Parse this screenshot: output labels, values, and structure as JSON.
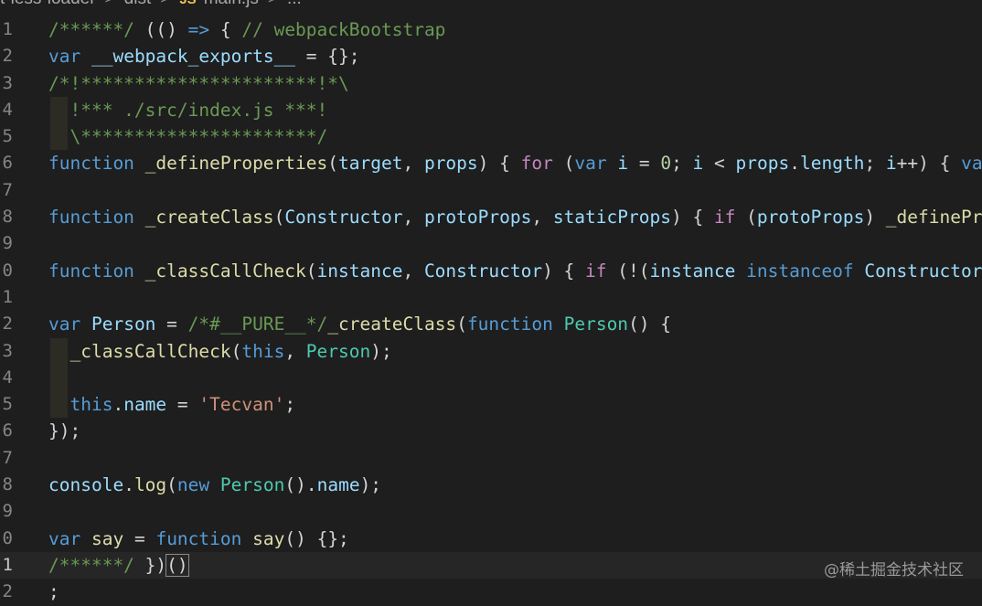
{
  "breadcrumb": {
    "segments": [
      "t-less-loader",
      "dist",
      "main.js",
      "..."
    ],
    "file_icon": "JS"
  },
  "editor": {
    "line_numbers": [
      "1",
      "2",
      "3",
      "4",
      "5",
      "6",
      "7",
      "8",
      "9",
      "0",
      "1",
      "2",
      "3",
      "4",
      "5",
      "6",
      "7",
      "8",
      "9",
      "0",
      "1",
      "2"
    ],
    "lines": [
      [
        [
          "m",
          "/******/ "
        ],
        [
          "p",
          "(() "
        ],
        [
          "k",
          "=>"
        ],
        [
          "p",
          " { "
        ],
        [
          "m",
          "// webpackBootstrap"
        ]
      ],
      [
        [
          "k",
          "var"
        ],
        [
          "p",
          " "
        ],
        [
          "v",
          "__webpack_exports__"
        ],
        [
          "p",
          " = {};"
        ]
      ],
      [
        [
          "m",
          "/*!**********************!*\\"
        ]
      ],
      [
        [
          "m",
          "  !*** ./src/index.js ***!"
        ]
      ],
      [
        [
          "m",
          "  \\**********************/"
        ]
      ],
      [
        [
          "k",
          "function"
        ],
        [
          "p",
          " "
        ],
        [
          "f",
          "_defineProperties"
        ],
        [
          "p",
          "("
        ],
        [
          "v",
          "target"
        ],
        [
          "p",
          ", "
        ],
        [
          "v",
          "props"
        ],
        [
          "p",
          ") { "
        ],
        [
          "c",
          "for"
        ],
        [
          "p",
          " ("
        ],
        [
          "k",
          "var"
        ],
        [
          "p",
          " "
        ],
        [
          "v",
          "i"
        ],
        [
          "p",
          " = "
        ],
        [
          "n",
          "0"
        ],
        [
          "p",
          "; "
        ],
        [
          "v",
          "i"
        ],
        [
          "p",
          " < "
        ],
        [
          "v",
          "props"
        ],
        [
          "p",
          "."
        ],
        [
          "v",
          "length"
        ],
        [
          "p",
          "; "
        ],
        [
          "v",
          "i"
        ],
        [
          "p",
          "++) { "
        ],
        [
          "k",
          "va"
        ]
      ],
      [],
      [
        [
          "k",
          "function"
        ],
        [
          "p",
          " "
        ],
        [
          "f",
          "_createClass"
        ],
        [
          "p",
          "("
        ],
        [
          "v",
          "Constructor"
        ],
        [
          "p",
          ", "
        ],
        [
          "v",
          "protoProps"
        ],
        [
          "p",
          ", "
        ],
        [
          "v",
          "staticProps"
        ],
        [
          "p",
          ") { "
        ],
        [
          "c",
          "if"
        ],
        [
          "p",
          " ("
        ],
        [
          "v",
          "protoProps"
        ],
        [
          "p",
          ") "
        ],
        [
          "f",
          "_definePr"
        ]
      ],
      [],
      [
        [
          "k",
          "function"
        ],
        [
          "p",
          " "
        ],
        [
          "f",
          "_classCallCheck"
        ],
        [
          "p",
          "("
        ],
        [
          "v",
          "instance"
        ],
        [
          "p",
          ", "
        ],
        [
          "v",
          "Constructor"
        ],
        [
          "p",
          ") { "
        ],
        [
          "c",
          "if"
        ],
        [
          "p",
          " (!("
        ],
        [
          "v",
          "instance"
        ],
        [
          "p",
          " "
        ],
        [
          "k",
          "instanceof"
        ],
        [
          "p",
          " "
        ],
        [
          "v",
          "Constructor"
        ]
      ],
      [],
      [
        [
          "k",
          "var"
        ],
        [
          "p",
          " "
        ],
        [
          "v",
          "Person"
        ],
        [
          "p",
          " = "
        ],
        [
          "m",
          "/*#__PURE__*/"
        ],
        [
          "f",
          "_createClass"
        ],
        [
          "p",
          "("
        ],
        [
          "k",
          "function"
        ],
        [
          "p",
          " "
        ],
        [
          "t",
          "Person"
        ],
        [
          "p",
          "() {"
        ]
      ],
      [
        [
          "p",
          "  "
        ],
        [
          "f",
          "_classCallCheck"
        ],
        [
          "p",
          "("
        ],
        [
          "k",
          "this"
        ],
        [
          "p",
          ", "
        ],
        [
          "t",
          "Person"
        ],
        [
          "p",
          ");"
        ]
      ],
      [],
      [
        [
          "p",
          "  "
        ],
        [
          "k",
          "this"
        ],
        [
          "p",
          "."
        ],
        [
          "v",
          "name"
        ],
        [
          "p",
          " = "
        ],
        [
          "s",
          "'Tecvan'"
        ],
        [
          "p",
          ";"
        ]
      ],
      [
        [
          "p",
          "});"
        ]
      ],
      [],
      [
        [
          "v",
          "console"
        ],
        [
          "p",
          "."
        ],
        [
          "f",
          "log"
        ],
        [
          "p",
          "("
        ],
        [
          "k",
          "new"
        ],
        [
          "p",
          " "
        ],
        [
          "t",
          "Person"
        ],
        [
          "p",
          "()."
        ],
        [
          "v",
          "name"
        ],
        [
          "p",
          ");"
        ]
      ],
      [],
      [
        [
          "k",
          "var"
        ],
        [
          "p",
          " "
        ],
        [
          "f",
          "say"
        ],
        [
          "p",
          " = "
        ],
        [
          "k",
          "function"
        ],
        [
          "p",
          " "
        ],
        [
          "f",
          "say"
        ],
        [
          "p",
          "() {};"
        ]
      ],
      [
        [
          "m",
          "/******/ "
        ],
        [
          "p",
          "})"
        ],
        [
          "br",
          "()"
        ]
      ],
      [
        [
          "p",
          ";"
        ]
      ]
    ],
    "active_line": 20,
    "indent_guide_lines": [
      3,
      4,
      12,
      13,
      14
    ]
  },
  "watermark": "@稀土掘金技术社区"
}
